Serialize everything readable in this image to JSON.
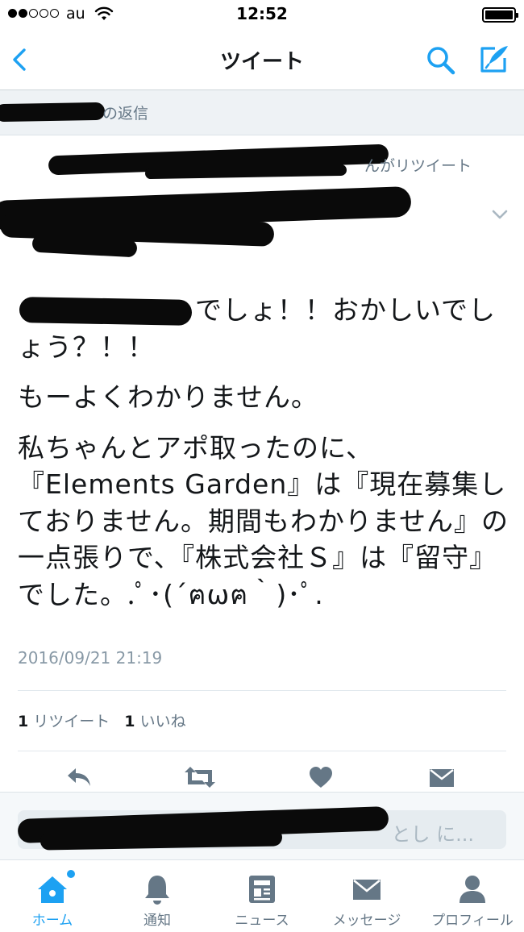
{
  "status_bar": {
    "carrier": "au",
    "time": "12:52"
  },
  "nav": {
    "title": "ツイート"
  },
  "reply_context": {
    "label": "の返信"
  },
  "retweet_info": {
    "label": "んがリツイート"
  },
  "tweet": {
    "paragraphs": [
      "でしょ！！おかしいでしょう？！！",
      "もーよくわかりません。",
      "私ちゃんとアポ取ったのに、『Elements Garden』は『現在募集しておりません。期間もわかりません』の一点張りで、『株式会社Ｓ』は『留守』でした。.ﾟ･(´ฅωฅ｀)･ﾟ."
    ],
    "timestamp": "2016/09/21 21:19"
  },
  "stats": {
    "retweet_count": "1",
    "retweet_label": "リツイート",
    "like_count": "1",
    "like_label": "いいね"
  },
  "reply_composer": {
    "placeholder_tail": "とし に..."
  },
  "tab_bar": {
    "tabs": [
      {
        "label": "ホーム",
        "icon": "home-icon",
        "active": true
      },
      {
        "label": "通知",
        "icon": "bell-icon",
        "active": false
      },
      {
        "label": "ニュース",
        "icon": "news-icon",
        "active": false
      },
      {
        "label": "メッセージ",
        "icon": "envelope-icon",
        "active": false
      },
      {
        "label": "プロフィール",
        "icon": "person-icon",
        "active": false
      }
    ]
  },
  "colors": {
    "accent": "#1da1f2",
    "icon_gray": "#657786",
    "muted_text": "#8899a6"
  }
}
